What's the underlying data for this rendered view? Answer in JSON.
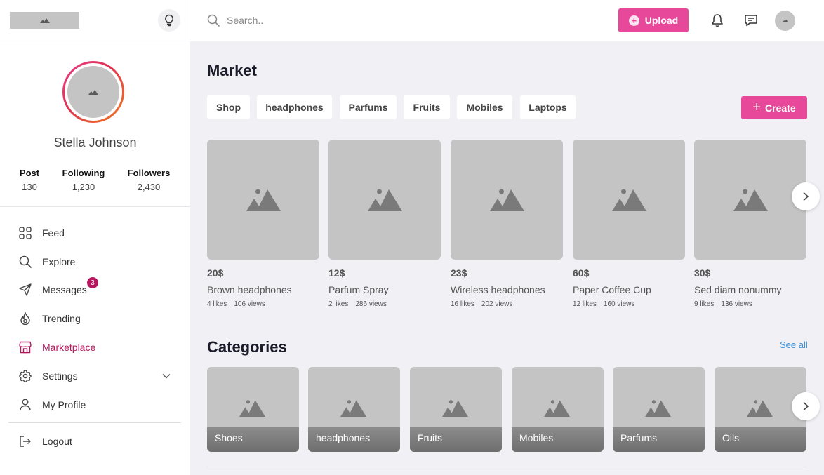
{
  "sidebar": {
    "profile": {
      "name": "Stella Johnson"
    },
    "stats": [
      {
        "label": "Post",
        "value": "130"
      },
      {
        "label": "Following",
        "value": "1,230"
      },
      {
        "label": "Followers",
        "value": "2,430"
      }
    ],
    "nav": [
      {
        "label": "Feed",
        "icon": "grid-icon"
      },
      {
        "label": "Explore",
        "icon": "search-icon"
      },
      {
        "label": "Messages",
        "icon": "send-icon",
        "badge": "3"
      },
      {
        "label": "Trending",
        "icon": "fire-icon"
      },
      {
        "label": "Marketplace",
        "icon": "store-icon",
        "active": true
      },
      {
        "label": "Settings",
        "icon": "gear-icon",
        "expandable": true
      },
      {
        "label": "My Profile",
        "icon": "user-icon"
      },
      {
        "label": "Logout",
        "icon": "logout-icon"
      }
    ]
  },
  "header": {
    "search_placeholder": "Search..",
    "upload_label": "Upload"
  },
  "market": {
    "title": "Market",
    "chips": [
      "Shop",
      "headphones",
      "Parfums",
      "Fruits",
      "Mobiles",
      "Laptops"
    ],
    "create_label": "Create",
    "products": [
      {
        "price": "20$",
        "name": "Brown headphones",
        "likes": "4 likes",
        "views": "106 views"
      },
      {
        "price": "12$",
        "name": "Parfum Spray",
        "likes": "2 likes",
        "views": "286 views"
      },
      {
        "price": "23$",
        "name": "Wireless headphones",
        "likes": "16 likes",
        "views": "202 views"
      },
      {
        "price": "60$",
        "name": "Paper Coffee Cup",
        "likes": "12 likes",
        "views": "160 views"
      },
      {
        "price": "30$",
        "name": "Sed diam nonummy",
        "likes": "9 likes",
        "views": "136 views"
      }
    ]
  },
  "categories": {
    "title": "Categories",
    "see_all": "See all",
    "items": [
      "Shoes",
      "headphones",
      "Fruits",
      "Mobiles",
      "Parfums",
      "Oils"
    ]
  },
  "colors": {
    "accent": "#e8489a",
    "active_nav": "#b5175f",
    "link": "#3d8fd6",
    "placeholder": "#c4c4c4"
  }
}
